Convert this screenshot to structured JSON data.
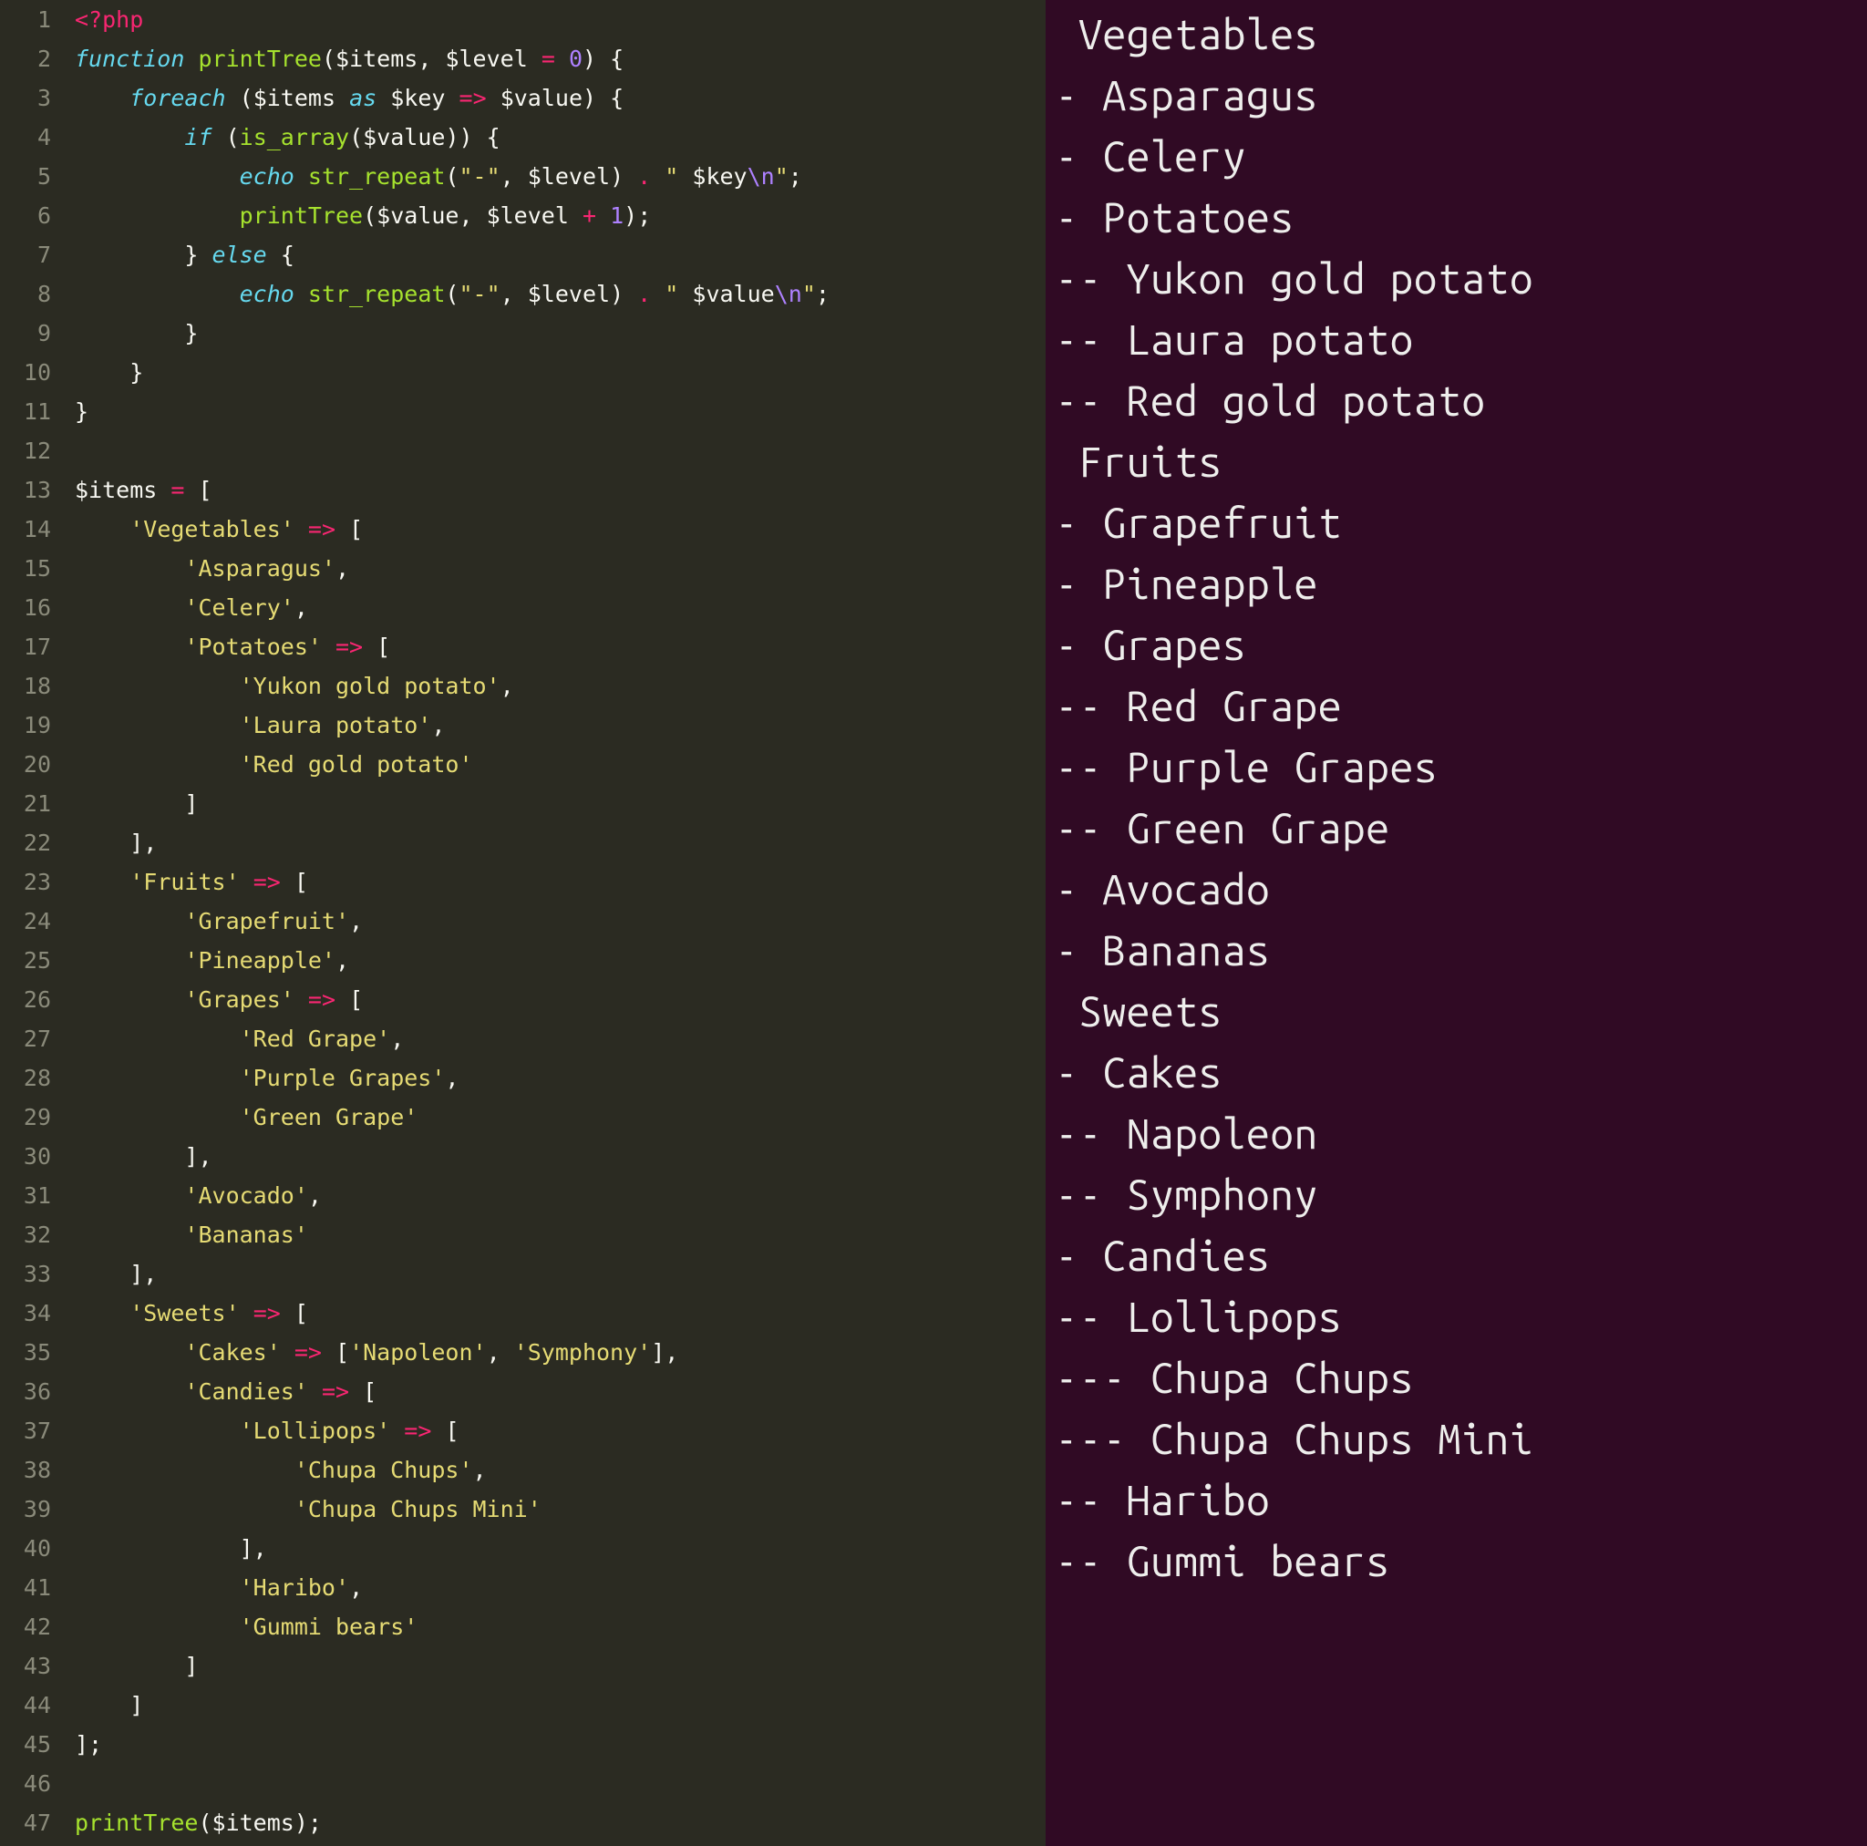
{
  "editor": {
    "lines": [
      {
        "n": 1,
        "tokens": [
          [
            "tag",
            "<?php"
          ]
        ]
      },
      {
        "n": 2,
        "tokens": [
          [
            "kw",
            "function"
          ],
          [
            "plain",
            " "
          ],
          [
            "func",
            "printTree"
          ],
          [
            "punc",
            "("
          ],
          [
            "var",
            "$items"
          ],
          [
            "punc",
            ", "
          ],
          [
            "var",
            "$level"
          ],
          [
            "plain",
            " "
          ],
          [
            "op",
            "="
          ],
          [
            "plain",
            " "
          ],
          [
            "num",
            "0"
          ],
          [
            "punc",
            ") {"
          ]
        ]
      },
      {
        "n": 3,
        "tokens": [
          [
            "plain",
            "    "
          ],
          [
            "kw",
            "foreach"
          ],
          [
            "plain",
            " "
          ],
          [
            "punc",
            "("
          ],
          [
            "var",
            "$items"
          ],
          [
            "plain",
            " "
          ],
          [
            "kw",
            "as"
          ],
          [
            "plain",
            " "
          ],
          [
            "var",
            "$key"
          ],
          [
            "plain",
            " "
          ],
          [
            "op",
            "=>"
          ],
          [
            "plain",
            " "
          ],
          [
            "var",
            "$value"
          ],
          [
            "punc",
            ") {"
          ]
        ]
      },
      {
        "n": 4,
        "tokens": [
          [
            "plain",
            "        "
          ],
          [
            "kw",
            "if"
          ],
          [
            "plain",
            " "
          ],
          [
            "punc",
            "("
          ],
          [
            "func",
            "is_array"
          ],
          [
            "punc",
            "("
          ],
          [
            "var",
            "$value"
          ],
          [
            "punc",
            ")) {"
          ]
        ]
      },
      {
        "n": 5,
        "tokens": [
          [
            "plain",
            "            "
          ],
          [
            "kw",
            "echo"
          ],
          [
            "plain",
            " "
          ],
          [
            "func",
            "str_repeat"
          ],
          [
            "punc",
            "("
          ],
          [
            "str",
            "\"-\""
          ],
          [
            "punc",
            ", "
          ],
          [
            "var",
            "$level"
          ],
          [
            "punc",
            ") "
          ],
          [
            "op",
            "."
          ],
          [
            "plain",
            " "
          ],
          [
            "str",
            "\" "
          ],
          [
            "var",
            "$key"
          ],
          [
            "esc",
            "\\n"
          ],
          [
            "str",
            "\""
          ],
          [
            "punc",
            ";"
          ]
        ]
      },
      {
        "n": 6,
        "tokens": [
          [
            "plain",
            "            "
          ],
          [
            "func",
            "printTree"
          ],
          [
            "punc",
            "("
          ],
          [
            "var",
            "$value"
          ],
          [
            "punc",
            ", "
          ],
          [
            "var",
            "$level"
          ],
          [
            "plain",
            " "
          ],
          [
            "op",
            "+"
          ],
          [
            "plain",
            " "
          ],
          [
            "num",
            "1"
          ],
          [
            "punc",
            ");"
          ]
        ]
      },
      {
        "n": 7,
        "tokens": [
          [
            "plain",
            "        "
          ],
          [
            "punc",
            "} "
          ],
          [
            "kw",
            "else"
          ],
          [
            "plain",
            " "
          ],
          [
            "punc",
            "{"
          ]
        ]
      },
      {
        "n": 8,
        "tokens": [
          [
            "plain",
            "            "
          ],
          [
            "kw",
            "echo"
          ],
          [
            "plain",
            " "
          ],
          [
            "func",
            "str_repeat"
          ],
          [
            "punc",
            "("
          ],
          [
            "str",
            "\"-\""
          ],
          [
            "punc",
            ", "
          ],
          [
            "var",
            "$level"
          ],
          [
            "punc",
            ") "
          ],
          [
            "op",
            "."
          ],
          [
            "plain",
            " "
          ],
          [
            "str",
            "\" "
          ],
          [
            "var",
            "$value"
          ],
          [
            "esc",
            "\\n"
          ],
          [
            "str",
            "\""
          ],
          [
            "punc",
            ";"
          ]
        ]
      },
      {
        "n": 9,
        "tokens": [
          [
            "plain",
            "        "
          ],
          [
            "punc",
            "}"
          ]
        ]
      },
      {
        "n": 10,
        "tokens": [
          [
            "plain",
            "    "
          ],
          [
            "punc",
            "}"
          ]
        ]
      },
      {
        "n": 11,
        "tokens": [
          [
            "punc",
            "}"
          ]
        ]
      },
      {
        "n": 12,
        "tokens": []
      },
      {
        "n": 13,
        "tokens": [
          [
            "var",
            "$items"
          ],
          [
            "plain",
            " "
          ],
          [
            "op",
            "="
          ],
          [
            "plain",
            " "
          ],
          [
            "punc",
            "["
          ]
        ]
      },
      {
        "n": 14,
        "tokens": [
          [
            "plain",
            "    "
          ],
          [
            "str",
            "'Vegetables'"
          ],
          [
            "plain",
            " "
          ],
          [
            "op",
            "=>"
          ],
          [
            "plain",
            " "
          ],
          [
            "punc",
            "["
          ]
        ]
      },
      {
        "n": 15,
        "tokens": [
          [
            "plain",
            "        "
          ],
          [
            "str",
            "'Asparagus'"
          ],
          [
            "punc",
            ","
          ]
        ]
      },
      {
        "n": 16,
        "tokens": [
          [
            "plain",
            "        "
          ],
          [
            "str",
            "'Celery'"
          ],
          [
            "punc",
            ","
          ]
        ]
      },
      {
        "n": 17,
        "tokens": [
          [
            "plain",
            "        "
          ],
          [
            "str",
            "'Potatoes'"
          ],
          [
            "plain",
            " "
          ],
          [
            "op",
            "=>"
          ],
          [
            "plain",
            " "
          ],
          [
            "punc",
            "["
          ]
        ]
      },
      {
        "n": 18,
        "tokens": [
          [
            "plain",
            "            "
          ],
          [
            "str",
            "'Yukon gold potato'"
          ],
          [
            "punc",
            ","
          ]
        ]
      },
      {
        "n": 19,
        "tokens": [
          [
            "plain",
            "            "
          ],
          [
            "str",
            "'Laura potato'"
          ],
          [
            "punc",
            ","
          ]
        ]
      },
      {
        "n": 20,
        "tokens": [
          [
            "plain",
            "            "
          ],
          [
            "str",
            "'Red gold potato'"
          ]
        ]
      },
      {
        "n": 21,
        "tokens": [
          [
            "plain",
            "        "
          ],
          [
            "punc",
            "]"
          ]
        ]
      },
      {
        "n": 22,
        "tokens": [
          [
            "plain",
            "    "
          ],
          [
            "punc",
            "],"
          ]
        ]
      },
      {
        "n": 23,
        "tokens": [
          [
            "plain",
            "    "
          ],
          [
            "str",
            "'Fruits'"
          ],
          [
            "plain",
            " "
          ],
          [
            "op",
            "=>"
          ],
          [
            "plain",
            " "
          ],
          [
            "punc",
            "["
          ]
        ]
      },
      {
        "n": 24,
        "tokens": [
          [
            "plain",
            "        "
          ],
          [
            "str",
            "'Grapefruit'"
          ],
          [
            "punc",
            ","
          ]
        ]
      },
      {
        "n": 25,
        "tokens": [
          [
            "plain",
            "        "
          ],
          [
            "str",
            "'Pineapple'"
          ],
          [
            "punc",
            ","
          ]
        ]
      },
      {
        "n": 26,
        "tokens": [
          [
            "plain",
            "        "
          ],
          [
            "str",
            "'Grapes'"
          ],
          [
            "plain",
            " "
          ],
          [
            "op",
            "=>"
          ],
          [
            "plain",
            " "
          ],
          [
            "punc",
            "["
          ]
        ]
      },
      {
        "n": 27,
        "tokens": [
          [
            "plain",
            "            "
          ],
          [
            "str",
            "'Red Grape'"
          ],
          [
            "punc",
            ","
          ]
        ]
      },
      {
        "n": 28,
        "tokens": [
          [
            "plain",
            "            "
          ],
          [
            "str",
            "'Purple Grapes'"
          ],
          [
            "punc",
            ","
          ]
        ]
      },
      {
        "n": 29,
        "tokens": [
          [
            "plain",
            "            "
          ],
          [
            "str",
            "'Green Grape'"
          ]
        ]
      },
      {
        "n": 30,
        "tokens": [
          [
            "plain",
            "        "
          ],
          [
            "punc",
            "],"
          ]
        ]
      },
      {
        "n": 31,
        "tokens": [
          [
            "plain",
            "        "
          ],
          [
            "str",
            "'Avocado'"
          ],
          [
            "punc",
            ","
          ]
        ]
      },
      {
        "n": 32,
        "tokens": [
          [
            "plain",
            "        "
          ],
          [
            "str",
            "'Bananas'"
          ]
        ]
      },
      {
        "n": 33,
        "tokens": [
          [
            "plain",
            "    "
          ],
          [
            "punc",
            "],"
          ]
        ]
      },
      {
        "n": 34,
        "tokens": [
          [
            "plain",
            "    "
          ],
          [
            "str",
            "'Sweets'"
          ],
          [
            "plain",
            " "
          ],
          [
            "op",
            "=>"
          ],
          [
            "plain",
            " "
          ],
          [
            "punc",
            "["
          ]
        ]
      },
      {
        "n": 35,
        "tokens": [
          [
            "plain",
            "        "
          ],
          [
            "str",
            "'Cakes'"
          ],
          [
            "plain",
            " "
          ],
          [
            "op",
            "=>"
          ],
          [
            "plain",
            " "
          ],
          [
            "punc",
            "["
          ],
          [
            "str",
            "'Napoleon'"
          ],
          [
            "punc",
            ", "
          ],
          [
            "str",
            "'Symphony'"
          ],
          [
            "punc",
            "],"
          ]
        ]
      },
      {
        "n": 36,
        "tokens": [
          [
            "plain",
            "        "
          ],
          [
            "str",
            "'Candies'"
          ],
          [
            "plain",
            " "
          ],
          [
            "op",
            "=>"
          ],
          [
            "plain",
            " "
          ],
          [
            "punc",
            "["
          ]
        ]
      },
      {
        "n": 37,
        "tokens": [
          [
            "plain",
            "            "
          ],
          [
            "str",
            "'Lollipops'"
          ],
          [
            "plain",
            " "
          ],
          [
            "op",
            "=>"
          ],
          [
            "plain",
            " "
          ],
          [
            "punc",
            "["
          ]
        ]
      },
      {
        "n": 38,
        "tokens": [
          [
            "plain",
            "                "
          ],
          [
            "str",
            "'Chupa Chups'"
          ],
          [
            "punc",
            ","
          ]
        ]
      },
      {
        "n": 39,
        "tokens": [
          [
            "plain",
            "                "
          ],
          [
            "str",
            "'Chupa Chups Mini'"
          ]
        ]
      },
      {
        "n": 40,
        "tokens": [
          [
            "plain",
            "            "
          ],
          [
            "punc",
            "],"
          ]
        ]
      },
      {
        "n": 41,
        "tokens": [
          [
            "plain",
            "            "
          ],
          [
            "str",
            "'Haribo'"
          ],
          [
            "punc",
            ","
          ]
        ]
      },
      {
        "n": 42,
        "tokens": [
          [
            "plain",
            "            "
          ],
          [
            "str",
            "'Gummi bears'"
          ]
        ]
      },
      {
        "n": 43,
        "tokens": [
          [
            "plain",
            "        "
          ],
          [
            "punc",
            "]"
          ]
        ]
      },
      {
        "n": 44,
        "tokens": [
          [
            "plain",
            "    "
          ],
          [
            "punc",
            "]"
          ]
        ]
      },
      {
        "n": 45,
        "tokens": [
          [
            "punc",
            "];"
          ]
        ]
      },
      {
        "n": 46,
        "tokens": []
      },
      {
        "n": 47,
        "tokens": [
          [
            "func",
            "printTree"
          ],
          [
            "punc",
            "("
          ],
          [
            "var",
            "$items"
          ],
          [
            "punc",
            ");"
          ]
        ]
      }
    ]
  },
  "terminal": {
    "lines": [
      " Vegetables",
      "- Asparagus",
      "- Celery",
      "- Potatoes",
      "-- Yukon gold potato",
      "-- Laura potato",
      "-- Red gold potato",
      " Fruits",
      "- Grapefruit",
      "- Pineapple",
      "- Grapes",
      "-- Red Grape",
      "-- Purple Grapes",
      "-- Green Grape",
      "- Avocado",
      "- Bananas",
      " Sweets",
      "- Cakes",
      "-- Napoleon",
      "-- Symphony",
      "- Candies",
      "-- Lollipops",
      "--- Chupa Chups",
      "--- Chupa Chups Mini",
      "-- Haribo",
      "-- Gummi bears"
    ]
  }
}
